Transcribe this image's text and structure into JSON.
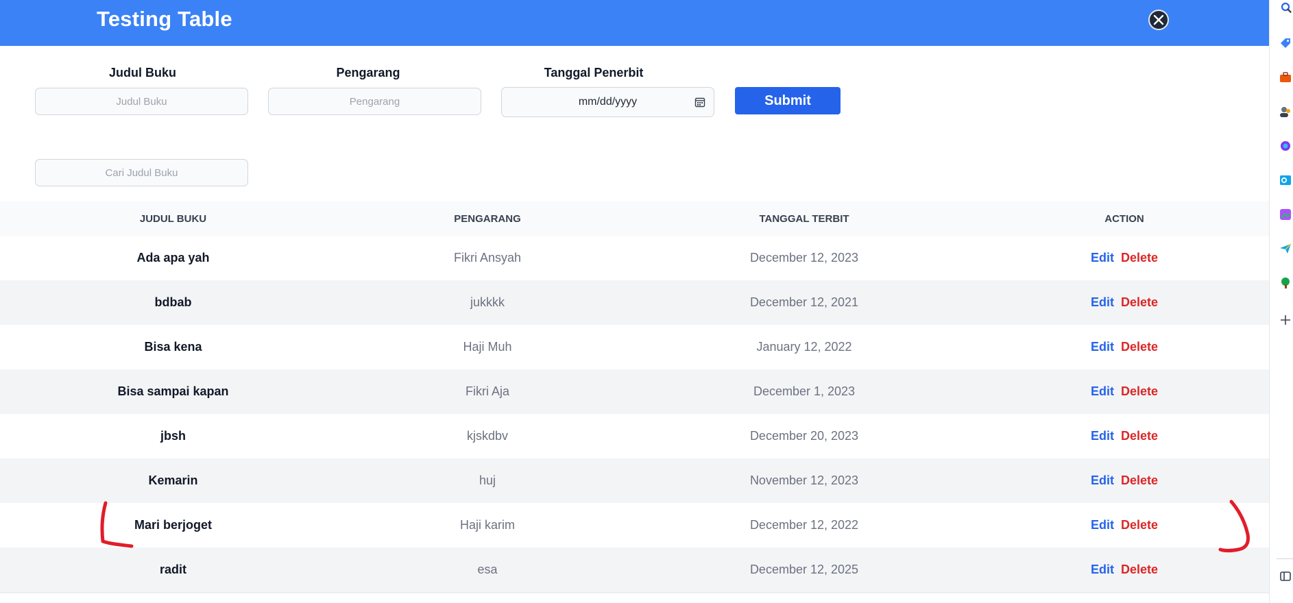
{
  "header": {
    "title": "Testing Table"
  },
  "form": {
    "judul": {
      "label": "Judul Buku",
      "placeholder": "Judul Buku"
    },
    "pengarang": {
      "label": "Pengarang",
      "placeholder": "Pengarang"
    },
    "tanggal": {
      "label": "Tanggal Penerbit",
      "placeholder": "mm/dd/yyyy"
    },
    "submit_label": "Submit"
  },
  "search": {
    "placeholder": "Cari Judul Buku"
  },
  "table": {
    "headers": [
      "JUDUL BUKU",
      "PENGARANG",
      "TANGGAL TERBIT",
      "ACTION"
    ],
    "rows": [
      {
        "judul": "Ada apa yah",
        "pengarang": "Fikri Ansyah",
        "tanggal": "December 12, 2023",
        "edit": "Edit",
        "delete": "Delete"
      },
      {
        "judul": "bdbab",
        "pengarang": "jukkkk",
        "tanggal": "December 12, 2021",
        "edit": "Edit",
        "delete": "Delete"
      },
      {
        "judul": "Bisa kena",
        "pengarang": "Haji Muh",
        "tanggal": "January 12, 2022",
        "edit": "Edit",
        "delete": "Delete"
      },
      {
        "judul": "Bisa sampai kapan",
        "pengarang": "Fikri Aja",
        "tanggal": "December 1, 2023",
        "edit": "Edit",
        "delete": "Delete"
      },
      {
        "judul": "jbsh",
        "pengarang": "kjskdbv",
        "tanggal": "December 20, 2023",
        "edit": "Edit",
        "delete": "Delete"
      },
      {
        "judul": "Kemarin",
        "pengarang": "huj",
        "tanggal": "November 12, 2023",
        "edit": "Edit",
        "delete": "Delete"
      },
      {
        "judul": "Mari berjoget",
        "pengarang": "Haji karim",
        "tanggal": "December 12, 2022",
        "edit": "Edit",
        "delete": "Delete"
      },
      {
        "judul": "radit",
        "pengarang": "esa",
        "tanggal": "December 12, 2025",
        "edit": "Edit",
        "delete": "Delete"
      }
    ]
  },
  "colors": {
    "header": "#3b82f6",
    "submit": "#2563eb",
    "edit": "#2563eb",
    "delete": "#dc2626",
    "annotation": "#e11d2a"
  },
  "icons": {
    "header": "x-logo-icon",
    "date": "calendar-icon",
    "sidebar": [
      "search-icon",
      "tag-icon",
      "briefcase-icon",
      "people-icon",
      "copilot-icon",
      "outlook-icon",
      "image-editor-icon",
      "send-icon",
      "tree-icon",
      "plus-icon",
      "sidebar-toggle-icon"
    ]
  }
}
